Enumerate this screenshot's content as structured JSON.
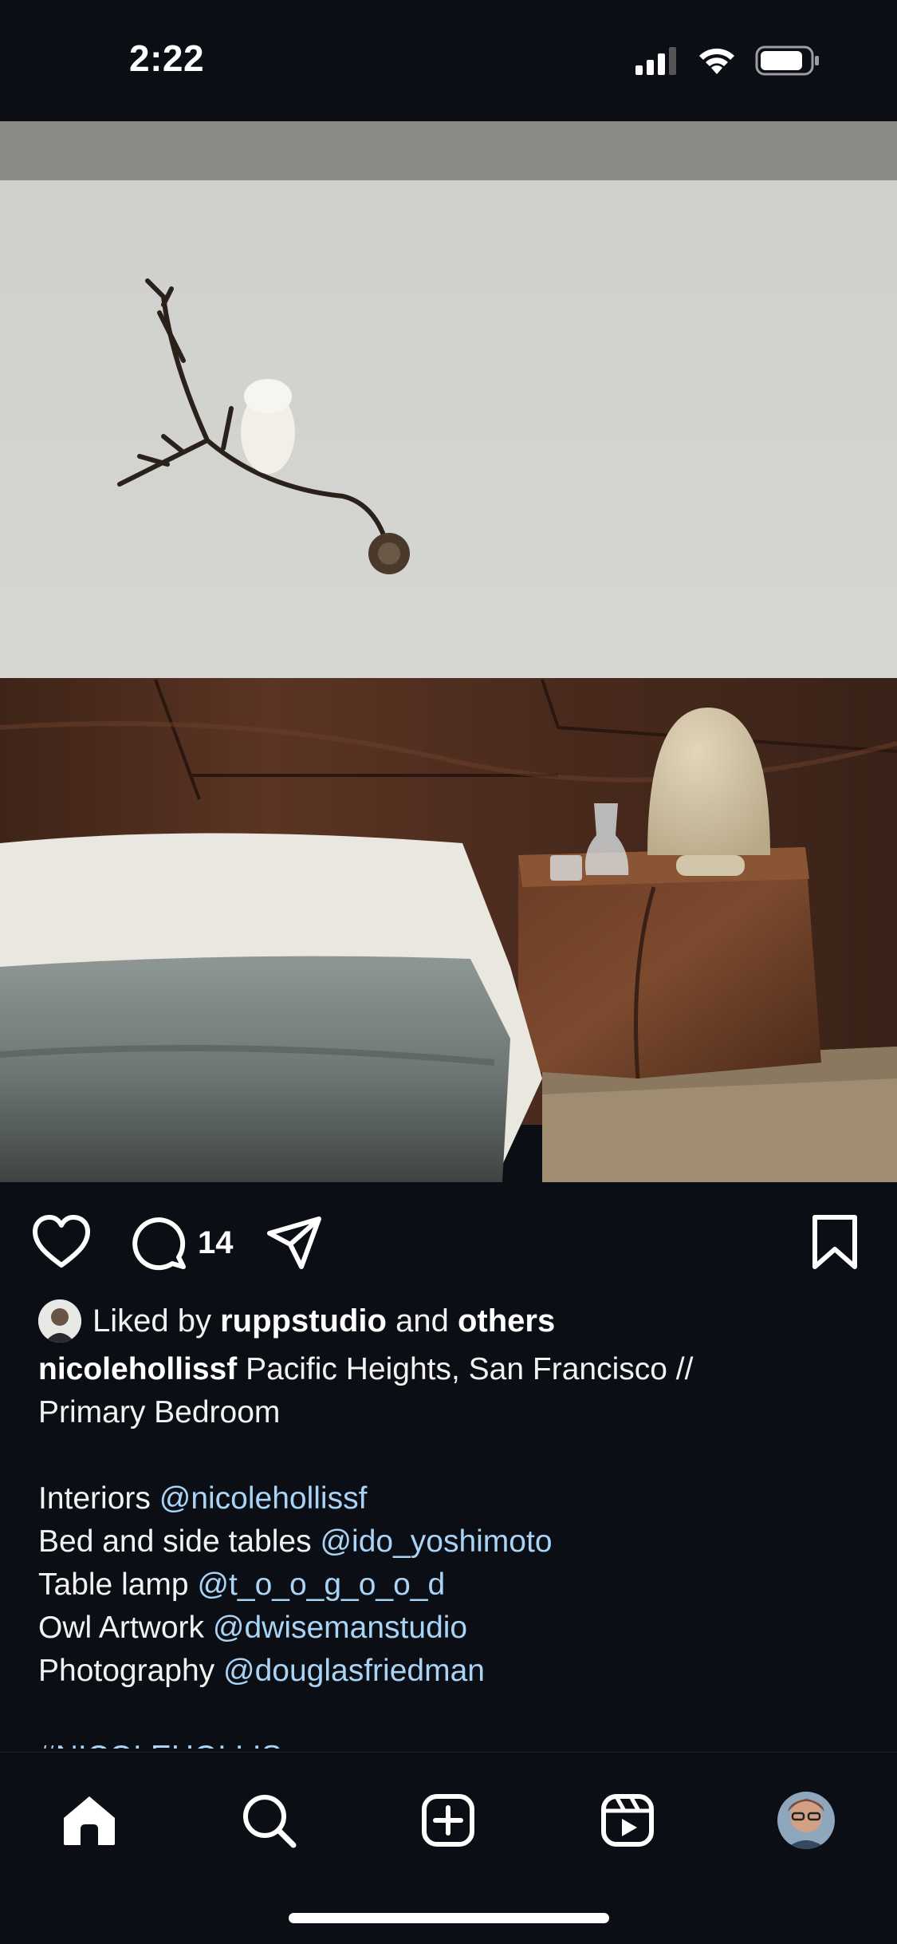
{
  "status_bar": {
    "time": "2:22"
  },
  "post": {
    "image_alt": "Bedroom with walnut headboard, owl on branch wall sculpture, bedside table and mushroom lamp",
    "comment_count": "14",
    "liked_by": {
      "prefix": "Liked by",
      "user": "ruppstudio",
      "conjunction": "and",
      "others": "others"
    },
    "caption": {
      "username": "nicolehollissf",
      "text_line1": "Pacific Heights, San Francisco //",
      "text_line2": "Primary Bedroom",
      "credits": [
        {
          "label": "Interiors",
          "mention": "@nicolehollissf"
        },
        {
          "label": "Bed and side tables",
          "mention": "@ido_yoshimoto"
        },
        {
          "label": "Table lamp",
          "mention": "@t_o_o_g_o_o_d"
        },
        {
          "label": "Owl Artwork",
          "mention": "@dwisemanstudio"
        },
        {
          "label": "Photography",
          "mention": "@douglasfriedman"
        }
      ],
      "hashtag": "#NICOLEHOLLIS"
    }
  },
  "icons": {
    "like": "heart-icon",
    "comment": "comment-bubble-icon",
    "share": "paper-plane-icon",
    "save": "bookmark-icon",
    "home": "home-icon",
    "search": "search-icon",
    "create": "plus-square-icon",
    "reels": "reels-icon",
    "profile": "avatar"
  },
  "colors": {
    "background": "#0b0e14",
    "mention": "#a9d4f5",
    "text": "#f2f2f2"
  }
}
